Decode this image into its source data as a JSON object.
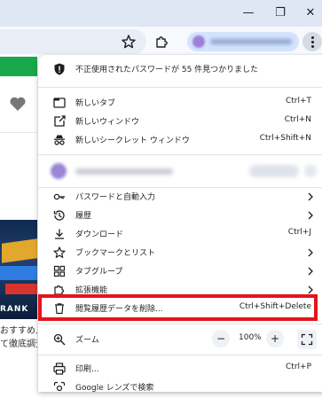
{
  "window": {
    "minimize_glyph": "—",
    "maximize_glyph": "❐",
    "close_glyph": "✕"
  },
  "toolbar": {
    "icons": [
      "bookmark-star-icon",
      "extensions-puzzle-icon",
      "chrome-menu-icon"
    ]
  },
  "page": {
    "banner_text": "RANK",
    "text_line_1": "おすすめ人",
    "text_line_2": "て徹底調査"
  },
  "menu": {
    "password_alert": "不正使用されたパスワードが 55 件見つかりました",
    "new_tab": {
      "label": "新しいタブ",
      "shortcut": "Ctrl+T"
    },
    "new_window": {
      "label": "新しいウィンドウ",
      "shortcut": "Ctrl+N"
    },
    "incognito": {
      "label": "新しいシークレット ウィンドウ",
      "shortcut": "Ctrl+Shift+N"
    },
    "passwords": {
      "label": "パスワードと自動入力"
    },
    "history": {
      "label": "履歴"
    },
    "downloads": {
      "label": "ダウンロード",
      "shortcut": "Ctrl+J"
    },
    "bookmarks": {
      "label": "ブックマークとリスト"
    },
    "tab_groups": {
      "label": "タブグループ"
    },
    "extensions": {
      "label": "拡張機能"
    },
    "clear_data": {
      "label": "閲覧履歴データを削除...",
      "shortcut": "Ctrl+Shift+Delete"
    },
    "zoom": {
      "label": "ズーム",
      "minus": "−",
      "value": "100%",
      "plus": "+"
    },
    "print": {
      "label": "印刷...",
      "shortcut": "Ctrl+P"
    },
    "lens": {
      "label": "Google レンズで検索"
    }
  },
  "colors": {
    "highlight_border": "#e5141b",
    "titlebar": "#dfe7f5",
    "profile_chip": "#d3e3fd"
  }
}
